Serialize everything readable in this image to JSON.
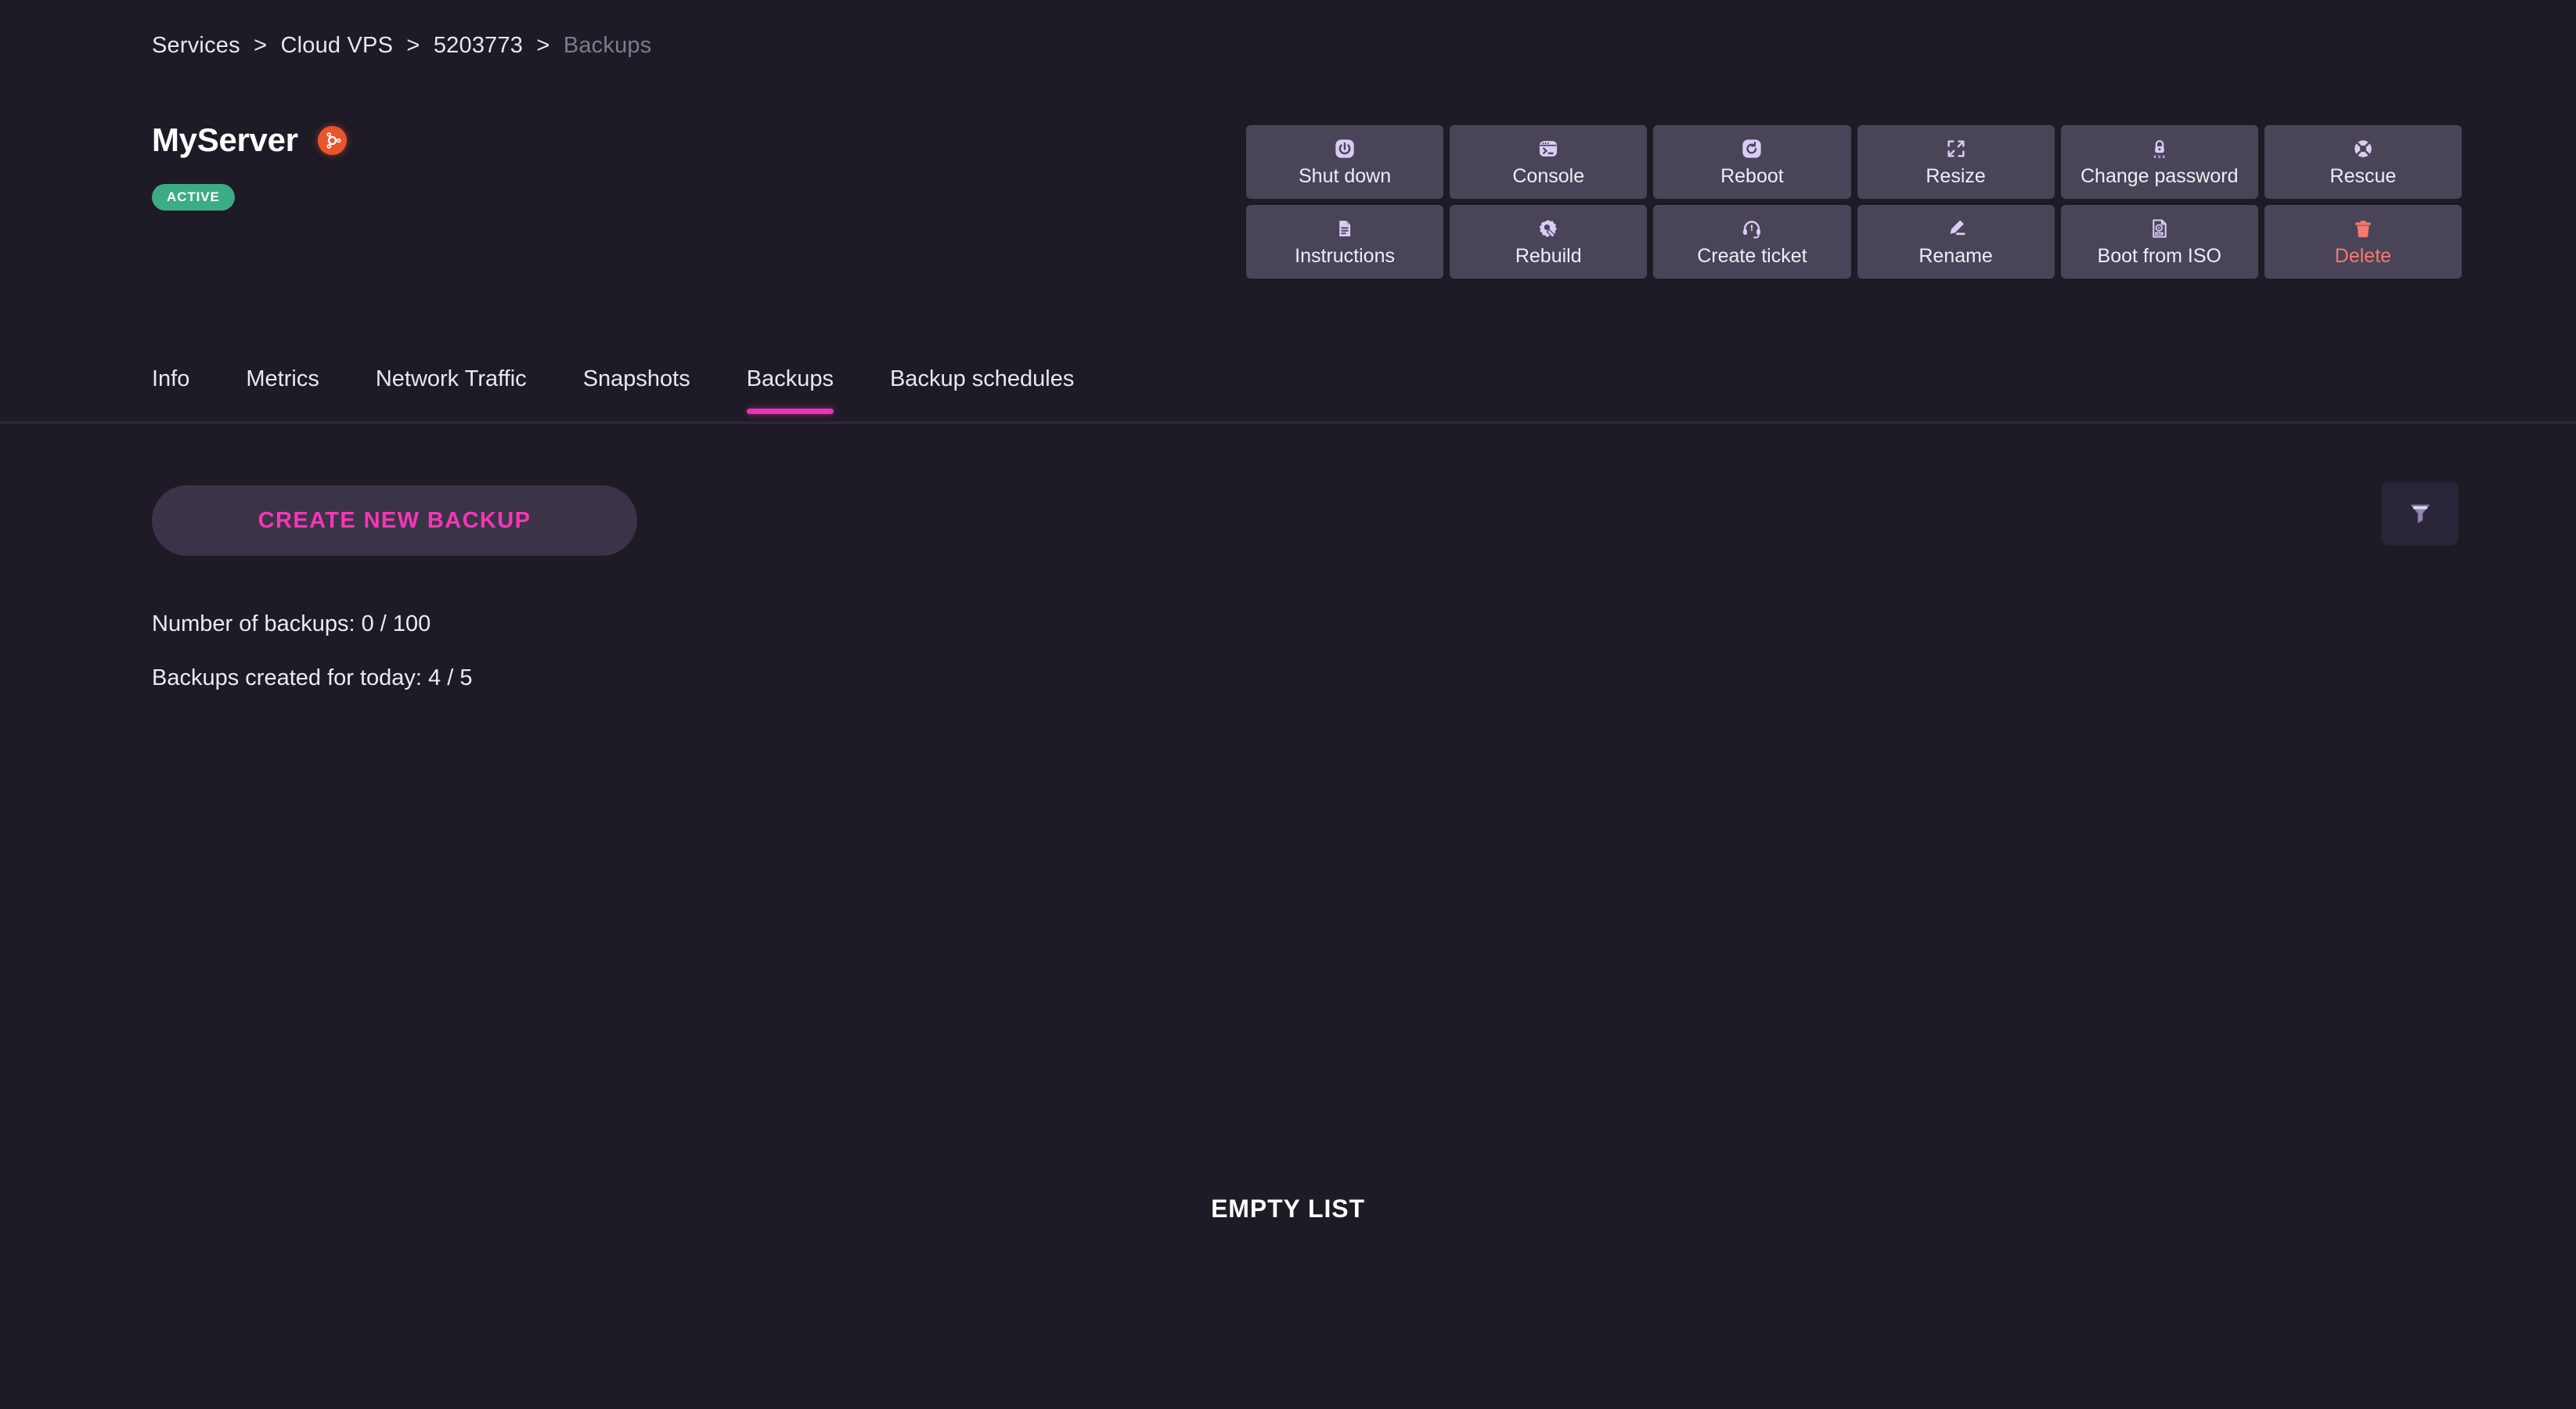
{
  "breadcrumb": {
    "items": [
      {
        "label": "Services",
        "current": false
      },
      {
        "label": "Cloud VPS",
        "current": false
      },
      {
        "label": "5203773",
        "current": false
      },
      {
        "label": "Backups",
        "current": true
      }
    ],
    "separator": ">"
  },
  "header": {
    "server_name": "MyServer",
    "os_icon": "ubuntu-logo-icon",
    "status_label": "ACTIVE",
    "status_color": "#3cac84"
  },
  "actions": [
    {
      "label": "Shut down",
      "icon": "power-icon",
      "danger": false
    },
    {
      "label": "Console",
      "icon": "terminal-icon",
      "danger": false
    },
    {
      "label": "Reboot",
      "icon": "restart-icon",
      "danger": false
    },
    {
      "label": "Resize",
      "icon": "expand-icon",
      "danger": false
    },
    {
      "label": "Change password",
      "icon": "lock-password-icon",
      "danger": false
    },
    {
      "label": "Rescue",
      "icon": "lifebuoy-icon",
      "danger": false
    },
    {
      "label": "Instructions",
      "icon": "document-icon",
      "danger": false
    },
    {
      "label": "Rebuild",
      "icon": "wrench-gear-icon",
      "danger": false
    },
    {
      "label": "Create ticket",
      "icon": "headset-icon",
      "danger": false
    },
    {
      "label": "Rename",
      "icon": "pencil-icon",
      "danger": false
    },
    {
      "label": "Boot from ISO",
      "icon": "iso-file-icon",
      "danger": false
    },
    {
      "label": "Delete",
      "icon": "trash-icon",
      "danger": true
    }
  ],
  "tabs": [
    {
      "label": "Info",
      "active": false
    },
    {
      "label": "Metrics",
      "active": false
    },
    {
      "label": "Network Traffic",
      "active": false
    },
    {
      "label": "Snapshots",
      "active": false
    },
    {
      "label": "Backups",
      "active": true
    },
    {
      "label": "Backup schedules",
      "active": false
    }
  ],
  "main": {
    "create_button_label": "CREATE NEW BACKUP",
    "count_total": "Number of backups: 0 / 100",
    "count_today": "Backups created for today: 4 / 5",
    "filter_icon": "filter-funnel-icon",
    "empty_state": "EMPTY LIST"
  },
  "colors": {
    "page_background": "#1e1a26",
    "action_button": "#4a4458",
    "accent_pink": "#f736b4",
    "tab_underline": "#ea34b8",
    "danger": "#f4796e",
    "icon_lavender": "#d8cdf5"
  }
}
